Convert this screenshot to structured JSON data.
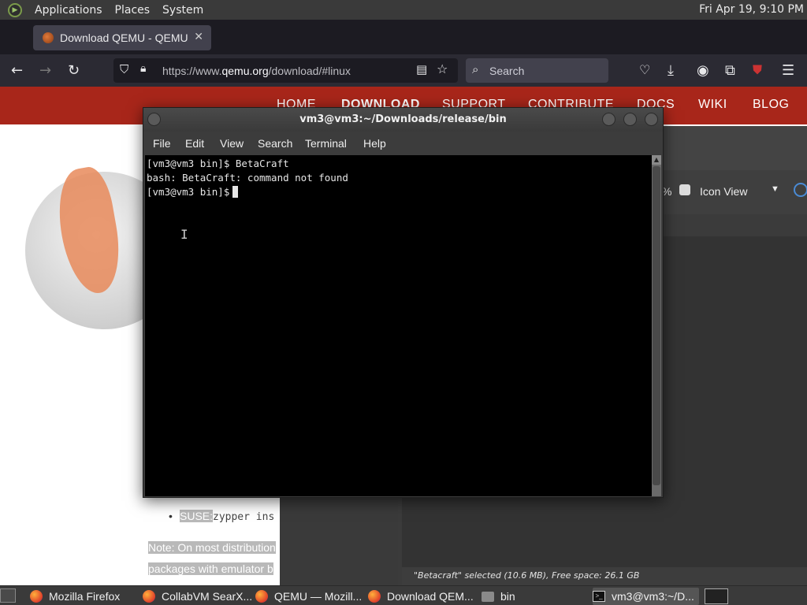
{
  "top_panel": {
    "menus": [
      "Applications",
      "Places",
      "System"
    ],
    "clock": "Fri Apr 19,  9:10 PM"
  },
  "firefox": {
    "tab_title": "Download QEMU - QEMU",
    "url_prefix": "https://www.",
    "url_host": "qemu.org",
    "url_path": "/download/#linux",
    "search_placeholder": "Search",
    "site_nav": [
      "HOME",
      "DOWNLOAD",
      "SUPPORT",
      "CONTRIBUTE",
      "DOCS",
      "WIKI",
      "BLOG"
    ],
    "suse_label": "SUSE:",
    "suse_cmd": "zypper ins",
    "note_line1": "Note: On most distribution",
    "note_line2": "packages with emulator b"
  },
  "file_manager": {
    "zoom_suffix": "%",
    "view_mode": "Icon View",
    "status": "\"Betacraft\" selected (10.6 MB), Free space: 26.1 GB"
  },
  "terminal": {
    "title": "vm3@vm3:~/Downloads/release/bin",
    "menu": [
      "File",
      "Edit",
      "View",
      "Search",
      "Terminal",
      "Help"
    ],
    "lines": [
      "[vm3@vm3 bin]$ BetaCraft",
      "bash: BetaCraft: command not found",
      "[vm3@vm3 bin]$"
    ]
  },
  "taskbar": {
    "items": [
      {
        "label": "Mozilla Firefox",
        "icon": "firefox-icon"
      },
      {
        "label": "CollabVM SearX...",
        "icon": "firefox-icon"
      },
      {
        "label": "QEMU — Mozill...",
        "icon": "firefox-icon"
      },
      {
        "label": "Download QEM...",
        "icon": "firefox-icon"
      },
      {
        "label": "bin",
        "icon": "folder-icon"
      },
      {
        "label": "vm3@vm3:~/D...",
        "icon": "terminal-icon"
      }
    ]
  }
}
